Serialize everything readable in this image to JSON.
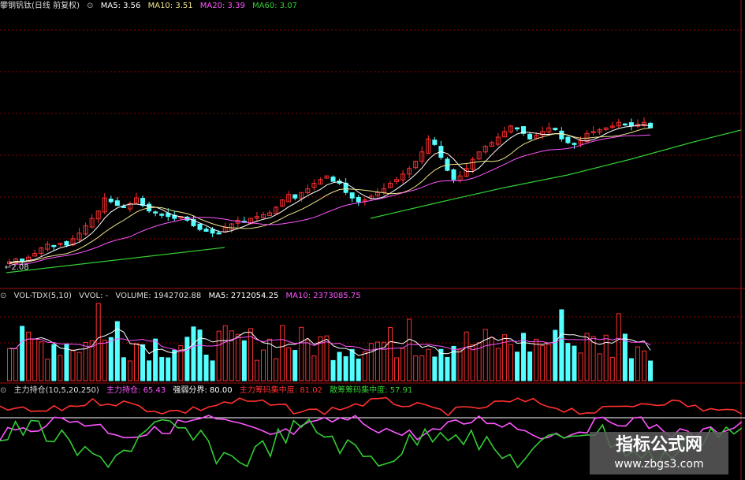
{
  "price_header": {
    "title": "攀钢钒钛(日线 前复权)",
    "ma5_label": "MA5: 3.56",
    "ma10_label": "MA10: 3.51",
    "ma20_label": "MA20: 3.39",
    "ma60_label": "MA60: 3.07"
  },
  "low_price_label": "2.08",
  "volume_header": {
    "title": "VOL-TDX(5,10)",
    "vvol": "VVOL: -",
    "volume": "VOLUME: 1942702.88",
    "ma5": "MA5: 2712054.25",
    "ma10": "MA10: 2373085.75"
  },
  "indicator_header": {
    "title": "主力持仓(10,5,20,250)",
    "holding": "主力持仓: 65.43",
    "boundary": "强弱分界: 80.00",
    "main_chip": "主力筹码集中度: 81.02",
    "retail_chip": "散筹筹码集中度: 57.91"
  },
  "watermark": {
    "title": "指标公式网",
    "url": "www.zbgs3.com"
  },
  "colors": {
    "up": "#ff3030",
    "down": "#54ffff",
    "ma5": "#ffffff",
    "ma10": "#f0e68c",
    "ma20": "#ff55ff",
    "ma60": "#32cd32",
    "grid": "#8b0000"
  },
  "chart_data": [
    {
      "type": "candlestick",
      "title": "攀钢钒钛(日线 前复权)",
      "close": [
        2.11,
        2.14,
        2.12,
        2.16,
        2.2,
        2.26,
        2.3,
        2.28,
        2.31,
        2.29,
        2.36,
        2.42,
        2.5,
        2.58,
        2.66,
        2.8,
        2.76,
        2.72,
        2.7,
        2.74,
        2.8,
        2.72,
        2.66,
        2.64,
        2.62,
        2.6,
        2.58,
        2.6,
        2.56,
        2.5,
        2.46,
        2.44,
        2.42,
        2.42,
        2.48,
        2.52,
        2.56,
        2.54,
        2.58,
        2.6,
        2.62,
        2.64,
        2.7,
        2.78,
        2.84,
        2.8,
        2.86,
        2.9,
        2.96,
        3.0,
        3.04,
        2.98,
        2.96,
        2.86,
        2.8,
        2.76,
        2.78,
        2.82,
        2.86,
        2.9,
        2.96,
        3.0,
        3.06,
        3.12,
        3.2,
        3.3,
        3.44,
        3.38,
        3.24,
        3.1,
        3.0,
        3.04,
        3.12,
        3.22,
        3.3,
        3.36,
        3.4,
        3.46,
        3.52,
        3.58,
        3.56,
        3.5,
        3.44,
        3.48,
        3.52,
        3.56,
        3.54,
        3.44,
        3.4,
        3.38,
        3.42,
        3.5,
        3.52,
        3.54,
        3.56,
        3.58,
        3.62,
        3.6,
        3.58,
        3.6,
        3.62,
        3.56
      ],
      "ma60_start_label": "2.08"
    },
    {
      "type": "bar",
      "title": "VOL-TDX(5,10)",
      "series": [
        {
          "name": "VOLUME",
          "last": 1942702.88
        },
        {
          "name": "MA5",
          "last": 2712054.25
        },
        {
          "name": "MA10",
          "last": 2373085.75
        }
      ]
    },
    {
      "type": "line",
      "title": "主力持仓(10,5,20,250)",
      "series": [
        {
          "name": "主力持仓",
          "last": 65.43
        },
        {
          "name": "强弱分界",
          "last": 80.0
        },
        {
          "name": "主力筹码集中度",
          "last": 81.02
        },
        {
          "name": "散筹筹码集中度",
          "last": 57.91
        }
      ]
    }
  ]
}
